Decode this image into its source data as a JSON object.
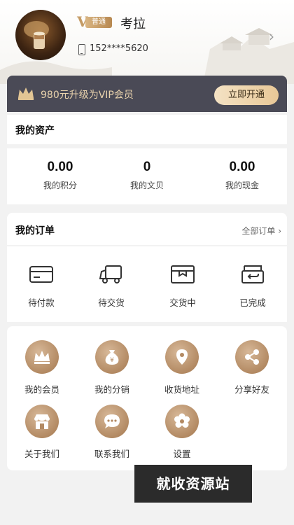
{
  "profile": {
    "badge_letter": "V",
    "badge_label": "普通",
    "name": "考拉",
    "phone": "152****5620"
  },
  "vip": {
    "text": "980元升级为VIP会员",
    "button": "立即开通"
  },
  "assets": {
    "title": "我的资产",
    "items": [
      {
        "value": "0.00",
        "label": "我的积分"
      },
      {
        "value": "0",
        "label": "我的文贝"
      },
      {
        "value": "0.00",
        "label": "我的现金"
      }
    ]
  },
  "orders": {
    "title": "我的订单",
    "all_link": "全部订单 ›",
    "items": [
      {
        "label": "待付款",
        "icon": "card-icon"
      },
      {
        "label": "待交货",
        "icon": "truck-icon"
      },
      {
        "label": "交货中",
        "icon": "box-icon"
      },
      {
        "label": "已完成",
        "icon": "return-box-icon"
      }
    ]
  },
  "services": {
    "items": [
      {
        "label": "我的会员",
        "icon": "crown-icon"
      },
      {
        "label": "我的分销",
        "icon": "money-bag-icon"
      },
      {
        "label": "收货地址",
        "icon": "location-pin-icon"
      },
      {
        "label": "分享好友",
        "icon": "share-icon"
      },
      {
        "label": "关于我们",
        "icon": "shop-icon"
      },
      {
        "label": "联系我们",
        "icon": "chat-icon"
      },
      {
        "label": "设置",
        "icon": "settings-icon"
      }
    ]
  },
  "watermark": "就收资源站",
  "colors": {
    "vip_bar": "#4a4a56",
    "vip_text": "#e9d3ad",
    "accent_gold": "#c49b64",
    "service_circle": "#b38a63",
    "page_bg": "#f2f2f2"
  }
}
